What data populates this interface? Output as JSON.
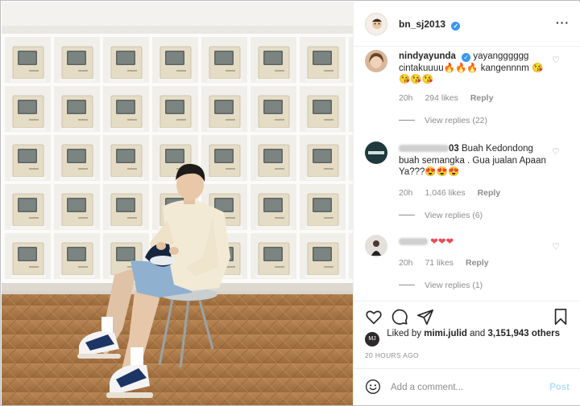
{
  "post": {
    "username": "bn_sj2013",
    "more_label": "···"
  },
  "comments": [
    {
      "username": "nindyayunda",
      "text": "yayangggggg cintakuuuu🔥🔥🔥 kangennnm 😘😘😘😘",
      "time": "20h",
      "likes": "294 likes",
      "reply_label": "Reply",
      "replies_label": "View replies (22)"
    },
    {
      "username_suffix": "03",
      "text": "Buah Kedondong buah semangka . Gua jualan Apaan Ya???😍😍😍",
      "time": "20h",
      "likes": "1,046 likes",
      "reply_label": "Reply",
      "replies_label": "View replies (6)"
    },
    {
      "text": "❤❤❤",
      "time": "20h",
      "likes": "71 likes",
      "reply_label": "Reply",
      "replies_label": "View replies (1)"
    }
  ],
  "likes_summary": {
    "prefix": "Liked by",
    "user": "mimi.julid",
    "and": "and",
    "count": "3,151,943 others"
  },
  "timestamp": "20 HOURS AGO",
  "comment_box": {
    "placeholder": "Add a comment...",
    "post_label": "Post"
  },
  "icons": [
    "heart-icon",
    "comment-icon",
    "share-icon",
    "bookmark-icon",
    "emoji-icon",
    "verified-icon",
    "more-icon"
  ]
}
